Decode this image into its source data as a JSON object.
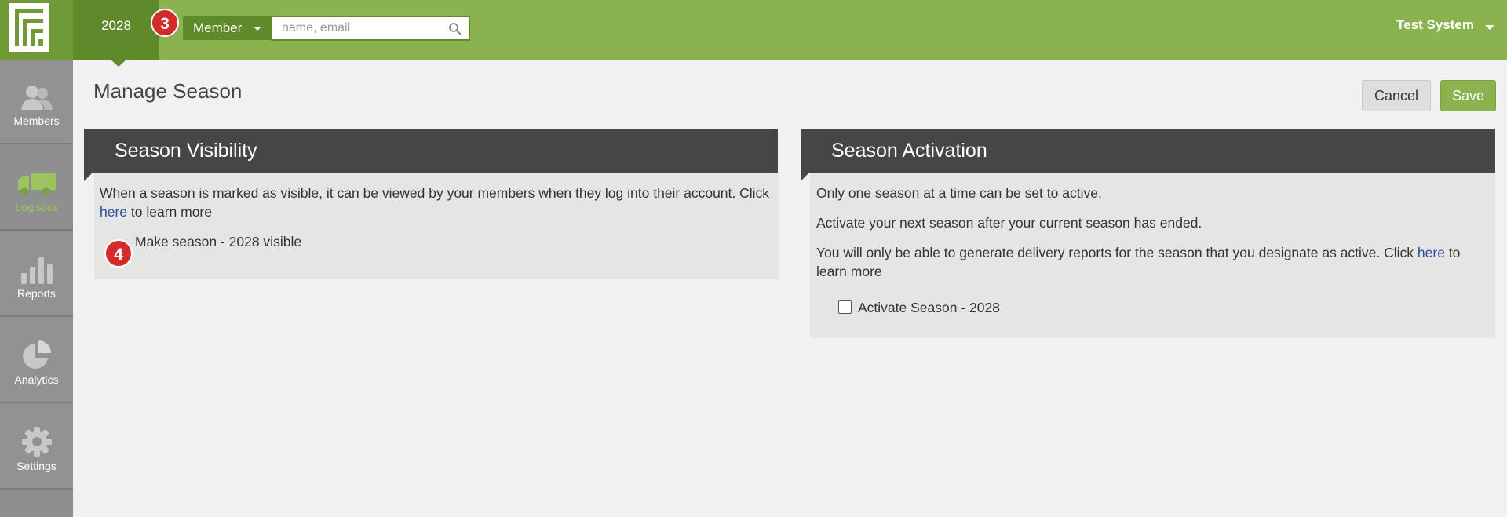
{
  "header": {
    "season_tab": "2028",
    "search_type": "Member",
    "search_placeholder": "name, email",
    "user": "Test System",
    "badge": "3"
  },
  "sidebar": {
    "items": [
      {
        "label": "Members",
        "icon": "members-icon"
      },
      {
        "label": "Logistics",
        "icon": "truck-icon",
        "active": true
      },
      {
        "label": "Reports",
        "icon": "bar-chart-icon"
      },
      {
        "label": "Analytics",
        "icon": "pie-chart-icon"
      },
      {
        "label": "Settings",
        "icon": "gear-icon"
      }
    ]
  },
  "page": {
    "title": "Manage Season",
    "cancel": "Cancel",
    "save": "Save"
  },
  "visibility": {
    "title": "Season Visibility",
    "text_before": "When a season is marked as visible, it can be viewed by your members when they log into their account.  Click ",
    "link": "here",
    "text_after": " to learn more",
    "badge": "4",
    "option": "Make season - 2028 visible"
  },
  "activation": {
    "title": "Season Activation",
    "line1": "Only one season at a time can be set to active.",
    "line2": "Activate your next season after your current season has ended.",
    "line3_before": "You will only be able to generate delivery reports for the season that you designate as active.  Click ",
    "link": "here",
    "line3_after": " to learn more",
    "option": "Activate Season - 2028"
  },
  "colors": {
    "brand_green": "#8ab24f",
    "dark_green": "#5f8a2c",
    "panel_header": "#464646",
    "badge_red": "#d42a2a"
  }
}
